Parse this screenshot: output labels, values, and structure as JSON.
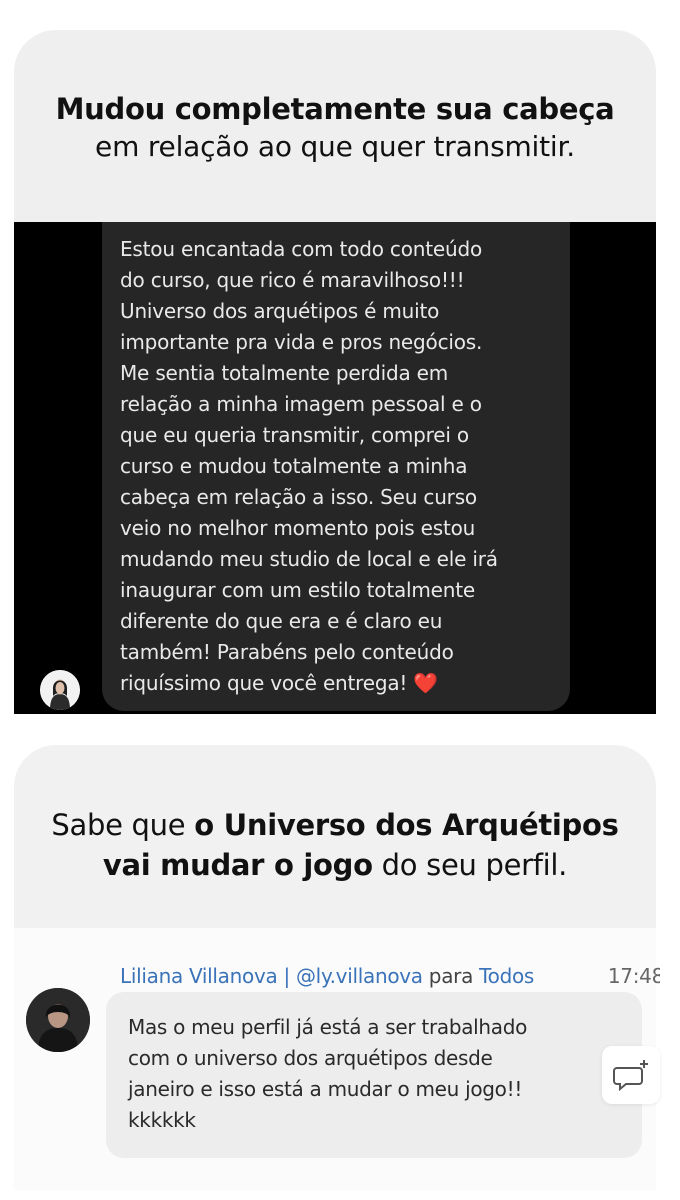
{
  "card_top": {
    "headline_bold": "Mudou completamente sua cabeça",
    "headline_regular": "em relação ao que quer transmitir."
  },
  "dark_message": {
    "text": "Estou encantada com todo conteúdo\ndo curso, que rico é maravilhoso!!!\nUniverso dos arquétipos é muito\nimportante pra vida e pros negócios.\nMe sentia totalmente perdida em\nrelação a minha imagem pessoal e o\nque eu queria transmitir, comprei o\ncurso e mudou totalmente a minha\ncabeça em relação a isso. Seu curso\nveio no melhor momento pois estou\nmudando meu studio de local e ele irá\ninaugurar com um estilo totalmente\ndiferente do que era e é claro eu\ntambém! Parabéns pelo conteúdo\nriquíssimo que você entrega!",
    "emoji": "❤️",
    "avatar_icon": "profile-avatar-icon"
  },
  "card_bottom": {
    "part1": "Sabe que ",
    "bold1": "o Universo dos Arquétipos",
    "bold2": "vai mudar o jogo",
    "part2": " do seu perfil."
  },
  "chat": {
    "sender_name": "Liliana Villanova | @ly.villanova",
    "para": " para ",
    "recipient": "Todos",
    "time": "17:48",
    "message": "Mas o meu perfil já está a ser trabalhado\ncom o universo dos arquétipos desde\njaneiro e isso está a mudar o meu jogo!!\nkkkkkk",
    "reply_icon": "reply-comment-icon",
    "colors": {
      "name": "#3b73b9",
      "bubble": "#ededed"
    }
  }
}
